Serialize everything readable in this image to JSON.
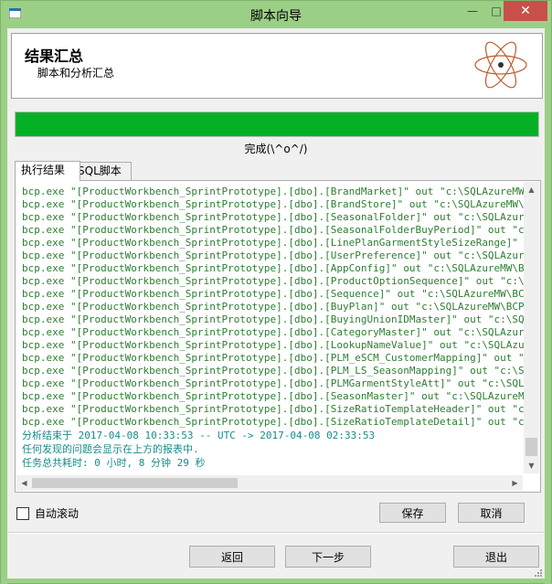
{
  "window": {
    "title": "脚本向导",
    "controls": {
      "minimize": "—",
      "maximize": "□",
      "close": "✕"
    }
  },
  "header": {
    "title": "结果汇总",
    "subtitle": "脚本和分析汇总",
    "logo_icon": "atom-icon"
  },
  "progress": {
    "value": 1.0,
    "color": "#06b025",
    "status_text": "完成(\\^o^/)"
  },
  "tabs": [
    {
      "label": "执行结果",
      "active": true
    },
    {
      "label": "SQL脚本",
      "active": false
    }
  ],
  "log": {
    "lines": [
      "bcp.exe \"[ProductWorkbench_SprintPrototype].[dbo].[BrandMarket]\" out \"c:\\SQLAzureMW\\BCPDa",
      "bcp.exe \"[ProductWorkbench_SprintPrototype].[dbo].[BrandStore]\" out \"c:\\SQLAzureMW\\BCPDat",
      "bcp.exe \"[ProductWorkbench_SprintPrototype].[dbo].[SeasonalFolder]\" out \"c:\\SQLAzureMW\\BCP",
      "bcp.exe \"[ProductWorkbench_SprintPrototype].[dbo].[SeasonalFolderBuyPeriod]\" out \"c:\\SQLAzu",
      "bcp.exe \"[ProductWorkbench_SprintPrototype].[dbo].[LinePlanGarmentStyleSizeRange]\" out \"c:\\S",
      "bcp.exe \"[ProductWorkbench_SprintPrototype].[dbo].[UserPreference]\" out \"c:\\SQLAzureMW\\BC",
      "bcp.exe \"[ProductWorkbench_SprintPrototype].[dbo].[AppConfig]\" out \"c:\\SQLAzureMW\\BCPData",
      "bcp.exe \"[ProductWorkbench_SprintPrototype].[dbo].[ProductOptionSequence]\" out \"c:\\SQLAzure",
      "bcp.exe \"[ProductWorkbench_SprintPrototype].[dbo].[Sequence]\" out \"c:\\SQLAzureMW\\BCPData",
      "bcp.exe \"[ProductWorkbench_SprintPrototype].[dbo].[BuyPlan]\" out \"c:\\SQLAzureMW\\BCPData\\d",
      "bcp.exe \"[ProductWorkbench_SprintPrototype].[dbo].[BuyingUnionIDMaster]\" out \"c:\\SQLAzureMW",
      "bcp.exe \"[ProductWorkbench_SprintPrototype].[dbo].[CategoryMaster]\" out \"c:\\SQLAzureMW\\BC",
      "bcp.exe \"[ProductWorkbench_SprintPrototype].[dbo].[LookupNameValue]\" out \"c:\\SQLAzureMW\\",
      "bcp.exe \"[ProductWorkbench_SprintPrototype].[dbo].[PLM_eSCM_CustomerMapping]\" out \"c:\\SQ",
      "bcp.exe \"[ProductWorkbench_SprintPrototype].[dbo].[PLM_LS_SeasonMapping]\" out \"c:\\SQLAzu",
      "bcp.exe \"[ProductWorkbench_SprintPrototype].[dbo].[PLMGarmentStyleAtt]\" out \"c:\\SQLAzureM",
      "bcp.exe \"[ProductWorkbench_SprintPrototype].[dbo].[SeasonMaster]\" out \"c:\\SQLAzureMW\\BCPI",
      "bcp.exe \"[ProductWorkbench_SprintPrototype].[dbo].[SizeRatioTemplateHeader]\" out \"c:\\SQLAzu",
      "bcp.exe \"[ProductWorkbench_SprintPrototype].[dbo].[SizeRatioTemplateDetail]\" out \"c:\\SQLAzu"
    ],
    "summary_end": "分析结束于 2017-04-08 10:33:53 -- UTC -> 2017-04-08 02:33:53",
    "summary_issues": "任何发现的问题会显示在上方的报表中.",
    "summary_time": "任务总共耗时: 0 小时, 8 分钟 29 秒"
  },
  "options": {
    "auto_scroll_label": "自动滚动",
    "auto_scroll_checked": false
  },
  "buttons": {
    "save": "保存",
    "cancel": "取消",
    "back": "返回",
    "next": "下一步",
    "exit": "退出"
  }
}
